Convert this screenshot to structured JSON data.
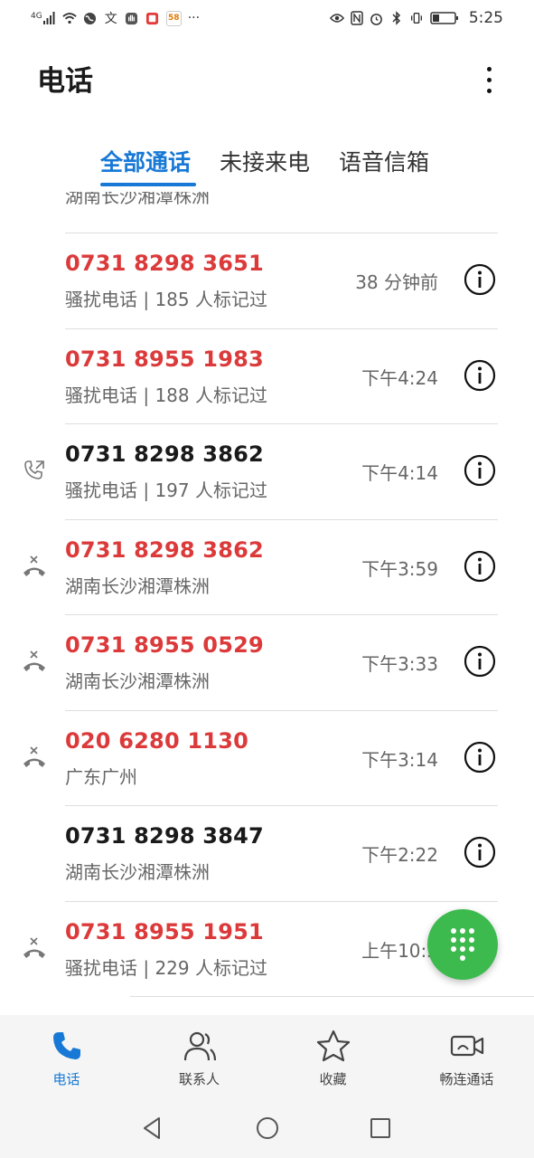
{
  "status_bar": {
    "network": "4G",
    "notif_badge": "58",
    "more": "···",
    "time": "5:25"
  },
  "header": {
    "title": "电话"
  },
  "tabs": [
    {
      "label": "全部通话",
      "active": true
    },
    {
      "label": "未接来电",
      "active": false
    },
    {
      "label": "语音信箱",
      "active": false
    }
  ],
  "partial_row_subtitle": "湖南长沙湘潭株洲",
  "calls": [
    {
      "number": "0731 8298 3651",
      "subtitle": "骚扰电话 | 185 人标记过",
      "time": "38 分钟前",
      "type": "none",
      "missed": true
    },
    {
      "number": "0731 8955 1983",
      "subtitle": "骚扰电话 | 188 人标记过",
      "time": "下午4:24",
      "type": "none",
      "missed": true
    },
    {
      "number": "0731 8298 3862",
      "subtitle": "骚扰电话 | 197 人标记过",
      "time": "下午4:14",
      "type": "outgoing",
      "missed": false
    },
    {
      "number": "0731 8298 3862",
      "subtitle": "湖南长沙湘潭株洲",
      "time": "下午3:59",
      "type": "rejected",
      "missed": true
    },
    {
      "number": "0731 8955 0529",
      "subtitle": "湖南长沙湘潭株洲",
      "time": "下午3:33",
      "type": "rejected",
      "missed": true
    },
    {
      "number": "020 6280 1130",
      "subtitle": "广东广州",
      "time": "下午3:14",
      "type": "rejected",
      "missed": true
    },
    {
      "number": "0731 8298 3847",
      "subtitle": "湖南长沙湘潭株洲",
      "time": "下午2:22",
      "type": "none",
      "missed": false
    },
    {
      "number": "0731 8955 1951",
      "subtitle": "骚扰电话 | 229 人标记过",
      "time": "上午10:5",
      "type": "rejected",
      "missed": true
    }
  ],
  "bottom_nav": [
    {
      "label": "电话",
      "icon": "phone-icon",
      "active": true
    },
    {
      "label": "联系人",
      "icon": "contacts-icon",
      "active": false
    },
    {
      "label": "收藏",
      "icon": "star-icon",
      "active": false
    },
    {
      "label": "畅连通话",
      "icon": "video-call-icon",
      "active": false
    }
  ],
  "colors": {
    "accent": "#1778d6",
    "missed": "#dc3a3a",
    "fab": "#3dba4e"
  }
}
